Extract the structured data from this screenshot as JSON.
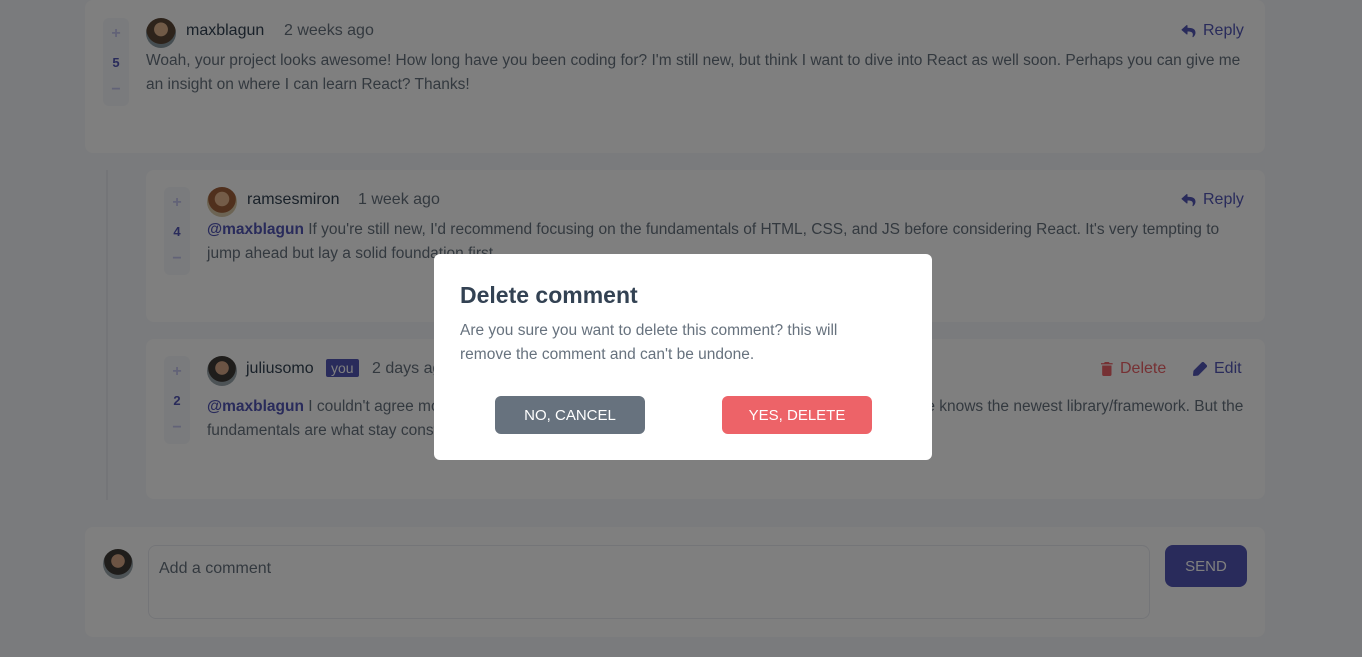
{
  "comments": [
    {
      "username": "maxblagun",
      "date": "2 weeks ago",
      "score": "5",
      "action": "Reply",
      "mention": "",
      "text": "Woah, your project looks awesome! How long have you been coding for? I'm still new, but think I want to dive into React as well soon. Perhaps you can give me an insight on where I can learn React? Thanks!"
    },
    {
      "username": "ramsesmiron",
      "date": "1 week ago",
      "score": "4",
      "action": "Reply",
      "mention": "@maxblagun",
      "text": "If you're still new, I'd recommend focusing on the fundamentals of HTML, CSS, and JS before considering React. It's very tempting to jump ahead but lay a solid foundation first."
    },
    {
      "username": "juliusomo",
      "badge": "you",
      "date": "2 days ago",
      "score": "2",
      "delete_label": "Delete",
      "edit_label": "Edit",
      "mention": "@maxblagun",
      "text": "I couldn't agree more with this. Everything moves so fast and it always seems like everyone knows the newest library/framework. But the fundamentals are what stay constant."
    }
  ],
  "vote": {
    "plus": "+",
    "minus": "−"
  },
  "composer": {
    "placeholder": "Add a comment",
    "send_label": "SEND"
  },
  "modal": {
    "title": "Delete comment",
    "text": "Are you sure you want to delete this comment? this will remove the comment and can't be undone.",
    "cancel_label": "NO, CANCEL",
    "confirm_label": "YES, DELETE"
  },
  "colors": {
    "accent": "#5357b6",
    "danger": "#ed6368",
    "neutral": "#67727e"
  }
}
